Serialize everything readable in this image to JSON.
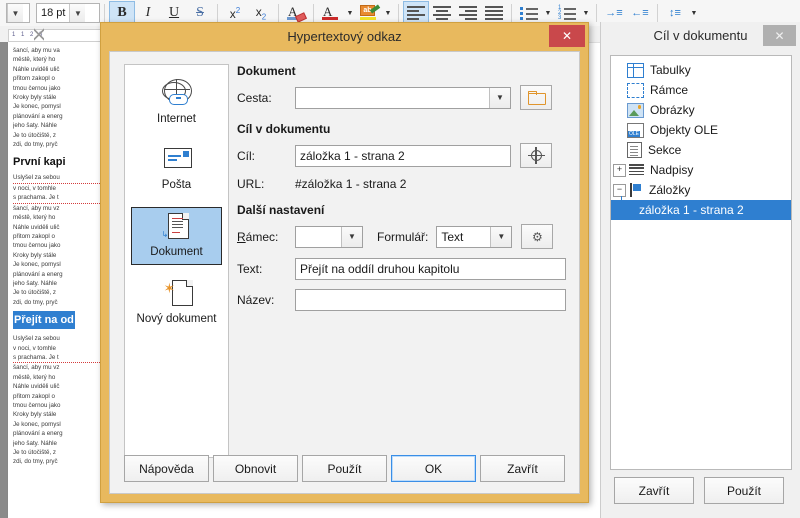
{
  "toolbar": {
    "font_size_value": "18 pt",
    "buttons": [
      {
        "name": "bold",
        "label": "B",
        "active": true
      },
      {
        "name": "italic",
        "label": "I",
        "active": false
      },
      {
        "name": "underline",
        "label": "U",
        "active": false
      },
      {
        "name": "strikethrough",
        "label": "S",
        "active": false
      },
      {
        "name": "superscript",
        "label": "x2",
        "active": false
      },
      {
        "name": "subscript",
        "label": "x2",
        "active": false
      },
      {
        "name": "clear-formatting",
        "label": "A",
        "active": false
      },
      {
        "name": "font-color",
        "label": "A",
        "active": false
      },
      {
        "name": "highlight-color",
        "label": "ab",
        "active": false
      },
      {
        "name": "align-left",
        "label": "",
        "active": true
      },
      {
        "name": "align-center",
        "label": "",
        "active": false
      },
      {
        "name": "align-right",
        "label": "",
        "active": false
      },
      {
        "name": "align-justify",
        "label": "",
        "active": false
      },
      {
        "name": "unordered-list",
        "label": "",
        "active": false
      },
      {
        "name": "ordered-list",
        "label": "",
        "active": false
      },
      {
        "name": "increase-indent",
        "label": "",
        "active": false
      },
      {
        "name": "decrease-indent",
        "label": "",
        "active": false
      },
      {
        "name": "line-spacing",
        "label": "",
        "active": false
      }
    ]
  },
  "ruler": {
    "marks": "1    1  2  3"
  },
  "document": {
    "paragraph_lines": [
      "šancí, aby mu va",
      "městě, který ho",
      "Náhle uviděli ulič",
      "přitom zakopl o",
      "tmou černou jako",
      "Kroky byly stále",
      "Je konec, pomysl",
      "plánování a energ",
      "jeho šaty. Náhle",
      "Je to útočiště, z",
      "zdi, do tmy, pryč"
    ],
    "heading_1": "První kapi",
    "paragraph_lines_2": [
      "Uslyšel za sebou",
      "v noci, v tomhle",
      "s prachama. Je t",
      "šancí, aby mu vz",
      "městě, který ho",
      "Náhle uviděli ulič",
      "přitom zakopl o",
      "tmou černou jako",
      "Kroky byly stále",
      "Je konec, pomysl",
      "plánování a energ",
      "jeho šaty. Náhle",
      "Je to útočiště, z",
      "zdi, do tmy, pryč"
    ],
    "heading_2": "Přejít na od",
    "paragraph_lines_3": [
      "Uslyšel za sebou",
      "v noci, v tomhle",
      "s prachama. Je t",
      "šancí, aby mu vz",
      "městě, který ho",
      "Náhle uviděli ulič",
      "přitom zakopl o",
      "tmou černou jako",
      "Kroky byly stále",
      "Je konec, pomysl",
      "plánování a energ",
      "jeho šaty. Náhle",
      "Je to útočiště, z",
      "zdi, do tmy, pryč"
    ]
  },
  "dialog": {
    "title": "Hypertextový odkaz",
    "close_label": "✕",
    "sidebar": [
      {
        "label": "Internet",
        "icon": "globe-link-icon",
        "active": false
      },
      {
        "label": "Pošta",
        "icon": "envelope-icon",
        "active": false
      },
      {
        "label": "Dokument",
        "icon": "document-icon",
        "active": true
      },
      {
        "label": "Nový dokument",
        "icon": "new-document-icon",
        "active": false
      }
    ],
    "group_document": {
      "title": "Dokument",
      "path_label": "Cesta:",
      "path_value": "",
      "browse_icon": "open-folder-icon"
    },
    "group_target": {
      "title": "Cíl v dokumentu",
      "target_label": "Cíl:",
      "target_value": "záložka 1 - strana 2",
      "target_picker_icon": "crosshair-target-icon",
      "url_label": "URL:",
      "url_value": "#záložka 1 - strana 2"
    },
    "group_more": {
      "title": "Další nastavení",
      "frame_label": "Rámec:",
      "frame_value": "",
      "form_label": "Formulář:",
      "form_value": "Text",
      "events_icon": "gear-events-icon",
      "text_label": "Text:",
      "text_value": "Přejít na oddíl druhou kapitolu",
      "name_label": "Název:",
      "name_value": ""
    },
    "buttons": [
      {
        "name": "help-button",
        "label": "Nápověda",
        "focused": false
      },
      {
        "name": "reset-button",
        "label": "Obnovit",
        "focused": false
      },
      {
        "name": "apply-button",
        "label": "Použít",
        "focused": false
      },
      {
        "name": "ok-button",
        "label": "OK",
        "focused": true
      },
      {
        "name": "close-button",
        "label": "Zavřít",
        "focused": false
      }
    ]
  },
  "right_panel": {
    "title": "Cíl v dokumentu",
    "close_label": "✕",
    "tree": [
      {
        "label": "Tabulky",
        "icon": "table-icon",
        "expander": "",
        "depth": 0,
        "selected": false
      },
      {
        "label": "Rámce",
        "icon": "frame-icon",
        "expander": "",
        "depth": 0,
        "selected": false
      },
      {
        "label": "Obrázky",
        "icon": "image-icon",
        "expander": "",
        "depth": 0,
        "selected": false
      },
      {
        "label": "Objekty OLE",
        "icon": "ole-object-icon",
        "expander": "",
        "depth": 0,
        "selected": false
      },
      {
        "label": "Sekce",
        "icon": "section-icon",
        "expander": "",
        "depth": 0,
        "selected": false
      },
      {
        "label": "Nadpisy",
        "icon": "headings-icon",
        "expander": "+",
        "depth": 0,
        "selected": false
      },
      {
        "label": "Záložky",
        "icon": "bookmark-flag-icon",
        "expander": "−",
        "depth": 0,
        "selected": false
      },
      {
        "label": "záložka 1 - strana 2",
        "icon": "",
        "expander": "",
        "depth": 1,
        "selected": true
      }
    ],
    "buttons": [
      {
        "name": "close-button",
        "label": "Zavřít"
      },
      {
        "name": "apply-button",
        "label": "Použít"
      }
    ]
  },
  "colors": {
    "dialog_frame": "#e8b95e",
    "dialog_close": "#c9484b",
    "selection_blue": "#2f7fd0",
    "active_item_blue": "#a8cdee",
    "focus_border": "#3a8ee6"
  }
}
